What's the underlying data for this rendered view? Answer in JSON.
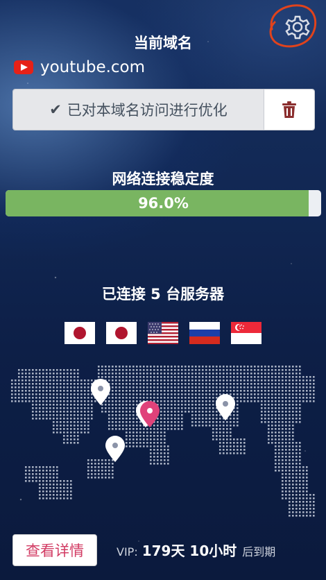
{
  "header": {
    "title": "当前域名",
    "settings_icon": "gear-icon"
  },
  "domain": {
    "icon": "youtube-icon",
    "name": "youtube.com"
  },
  "optimization": {
    "status_icon": "check-icon",
    "status_text": "已对本域名访问进行优化",
    "delete_icon": "trash-icon"
  },
  "stability": {
    "label": "网络连接稳定度",
    "percent": 96.0,
    "text": "96.0%"
  },
  "servers": {
    "label": "已连接 5 台服务器",
    "flags": [
      "japan-flag",
      "japan-flag",
      "usa-flag",
      "russia-flag",
      "singapore-flag"
    ]
  },
  "map": {
    "pins": [
      "location-pin",
      "location-pin",
      "location-pin",
      "location-pin",
      "location-pin"
    ]
  },
  "footer": {
    "details_button": "查看详情",
    "vip_label": "VIP:",
    "vip_value": "179天 10小时",
    "vip_suffix": "后到期"
  },
  "colors": {
    "progress": "#79b561",
    "accent_pink": "#d23b63",
    "youtube_red": "#e62117",
    "annotation_circle": "#e0431c"
  }
}
